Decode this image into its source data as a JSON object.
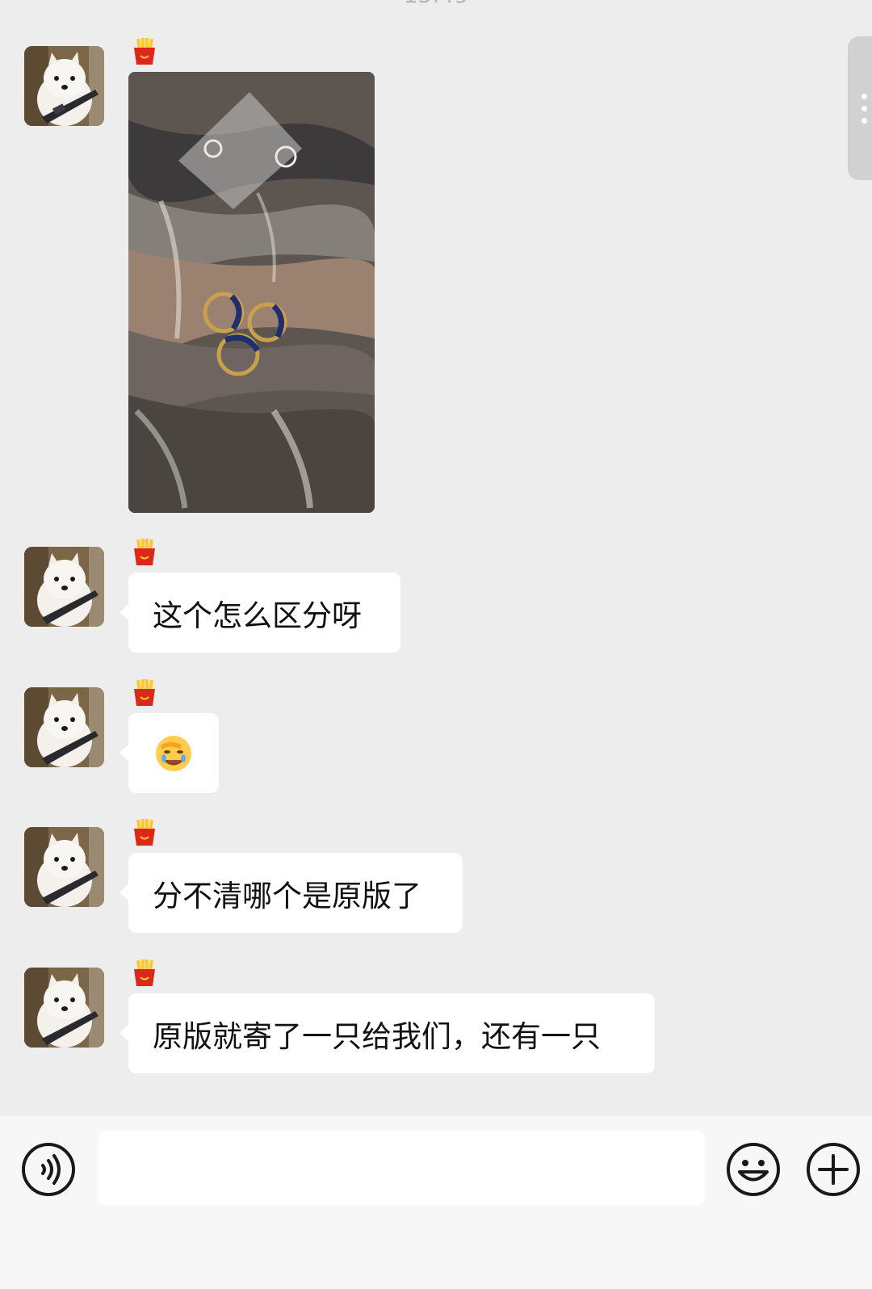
{
  "status": {
    "time": "15:49"
  },
  "chat": {
    "messages": [
      {
        "type": "image",
        "content": ""
      },
      {
        "type": "text",
        "content": "这个怎么区分呀"
      },
      {
        "type": "emoji",
        "content": "🤦"
      },
      {
        "type": "text",
        "content": "分不清哪个是原版了"
      },
      {
        "type": "text",
        "content": "原版就寄了一只给我们，还有一只"
      }
    ]
  },
  "input": {
    "placeholder": "",
    "value": ""
  },
  "icons": {
    "voice": "voice-icon",
    "emoji": "smiley-icon",
    "plus": "plus-icon",
    "badge": "fries-badge-icon"
  },
  "colors": {
    "background": "#ededed",
    "bubble": "#ffffff",
    "input_bar": "#f7f7f7"
  }
}
